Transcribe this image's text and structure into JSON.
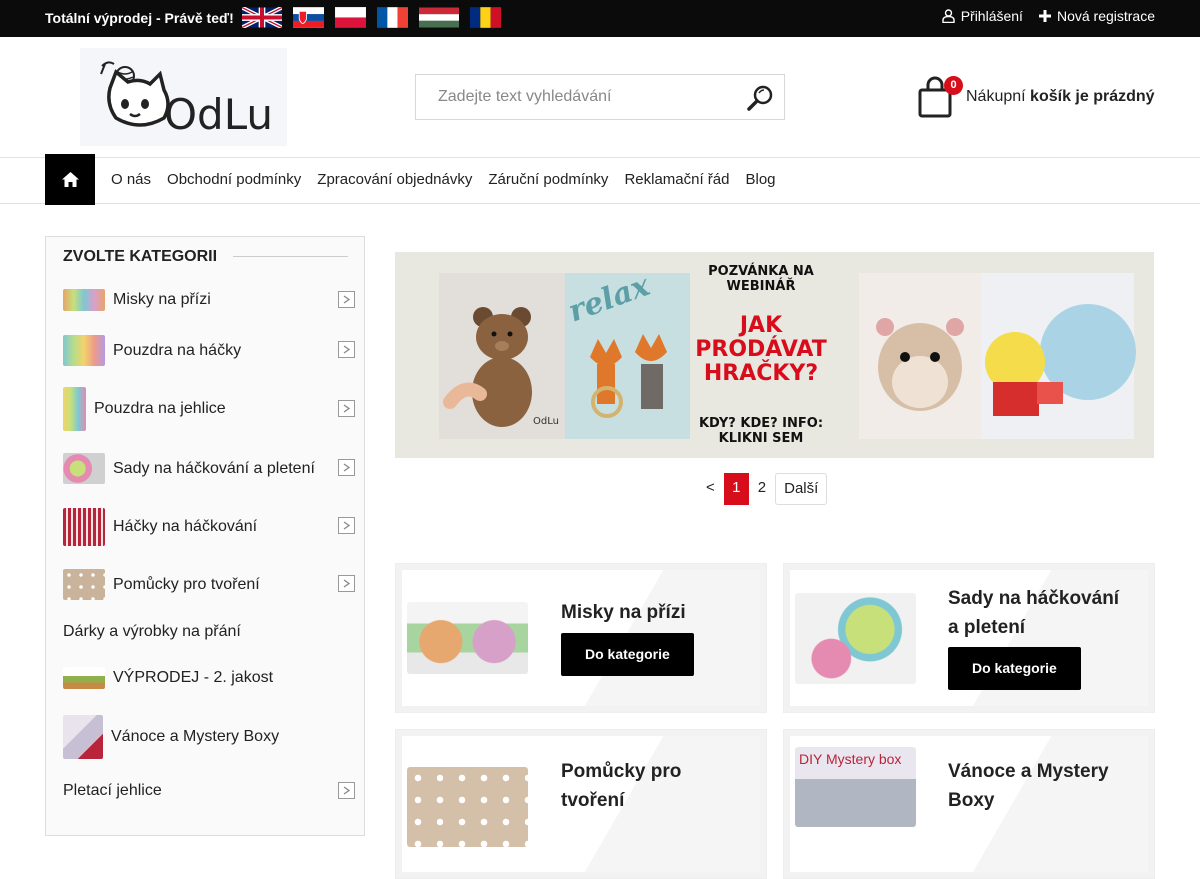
{
  "topbar": {
    "promo": "Totální výprodej - Právě teď!",
    "flags": [
      "uk-flag-icon",
      "slovakia-flag-icon",
      "poland-flag-icon",
      "france-flag-icon",
      "hungary-flag-icon",
      "romania-flag-icon"
    ],
    "login": "Přihlášení",
    "register": "Nová registrace"
  },
  "brand": {
    "logo_text": "OdLu"
  },
  "search": {
    "placeholder": "Zadejte text vyhledávání"
  },
  "cart": {
    "count": "0",
    "label_prefix": "Nákupní",
    "label_strong": "košík je prázdný"
  },
  "nav": {
    "items": [
      "O nás",
      "Obchodní podmínky",
      "Zpracování objednávky",
      "Záruční podmínky",
      "Reklamační řád",
      "Blog"
    ]
  },
  "sidebar": {
    "title": "ZVOLTE KATEGORII",
    "items": [
      {
        "label": "Misky na přízi",
        "has_thumb": true,
        "has_arrow": true
      },
      {
        "label": "Pouzdra na háčky",
        "has_thumb": true,
        "has_arrow": true
      },
      {
        "label": "Pouzdra na jehlice",
        "has_thumb": true,
        "has_arrow": true
      },
      {
        "label": "Sady na háčkování a pletení",
        "has_thumb": true,
        "has_arrow": true
      },
      {
        "label": "Háčky na háčkování",
        "has_thumb": true,
        "has_arrow": true
      },
      {
        "label": "Pomůcky pro tvoření",
        "has_thumb": true,
        "has_arrow": true
      },
      {
        "label": "Dárky a výrobky na přání",
        "has_thumb": false,
        "has_arrow": false
      },
      {
        "label": "VÝPRODEJ - 2. jakost",
        "has_thumb": true,
        "has_arrow": false
      },
      {
        "label": "Vánoce a Mystery Boxy",
        "has_thumb": true,
        "has_arrow": false
      },
      {
        "label": "Pletací jehlice",
        "has_thumb": false,
        "has_arrow": true
      }
    ]
  },
  "banner": {
    "line1": "POZVÁNKA NA",
    "line2": "WEBINÁŘ",
    "line3": "JAK",
    "line4": "PRODÁVAT",
    "line5": "HRAČKY?",
    "line6": "KDY? KDE? INFO:",
    "line7": "KLIKNI SEM",
    "relax_text": "relax",
    "watermark": "OdLu"
  },
  "pager": {
    "prev": "<",
    "page1": "1",
    "page2": "2",
    "next": "Další"
  },
  "tiles": [
    {
      "title_line1": "Misky na přízi",
      "title_line2": "",
      "button": "Do kategorie"
    },
    {
      "title_line1": "Sady na háčkování",
      "title_line2": "a pletení",
      "button": "Do kategorie"
    },
    {
      "title_line1": "Pomůcky pro",
      "title_line2": "tvoření",
      "button": ""
    },
    {
      "title_line1": "Vánoce a Mystery",
      "title_line2": "Boxy",
      "button": "",
      "img_text": "DIY Mystery box"
    }
  ],
  "colors": {
    "accent": "#d80d1c",
    "topbar": "#0b0b0b",
    "button": "#000000"
  }
}
